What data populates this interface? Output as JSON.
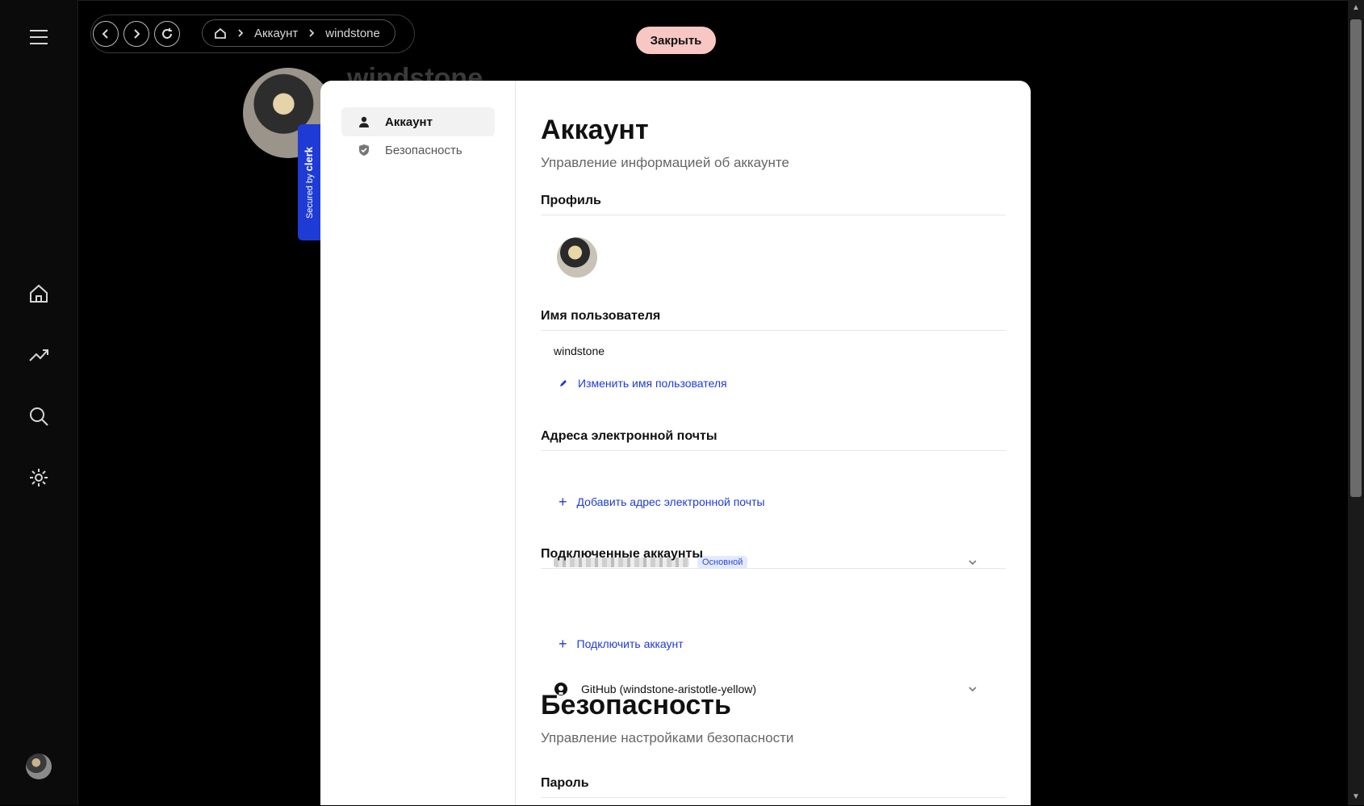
{
  "nav": {
    "breadcrumb": [
      "Аккаунт",
      "windstone"
    ],
    "close_label": "Закрыть"
  },
  "background": {
    "username": "windstone"
  },
  "clerk_badge": {
    "secured_by": "Secured by",
    "brand": "clerk"
  },
  "modal": {
    "sidebar": [
      {
        "label": "Аккаунт",
        "icon": "user-icon",
        "active": true
      },
      {
        "label": "Безопасность",
        "icon": "shield-icon",
        "active": false
      }
    ],
    "account": {
      "title": "Аккаунт",
      "subtitle": "Управление информацией об аккаунте",
      "profile_heading": "Профиль",
      "username_heading": "Имя пользователя",
      "username": "windstone",
      "change_username": "Изменить имя пользователя",
      "email_heading": "Адреса электронной почты",
      "email_badge": "Основной",
      "add_email": "Добавить адрес электронной почты",
      "connected_heading": "Подключенные аккаунты",
      "github": "GitHub (windstone-aristotle-yellow)",
      "connect_account": "Подключить аккаунт"
    },
    "security": {
      "title": "Безопасность",
      "subtitle": "Управление настройками безопасности",
      "password_heading": "Пароль"
    }
  },
  "colors": {
    "accent": "#1f3bd6",
    "close_button": "#f8c7c3"
  }
}
